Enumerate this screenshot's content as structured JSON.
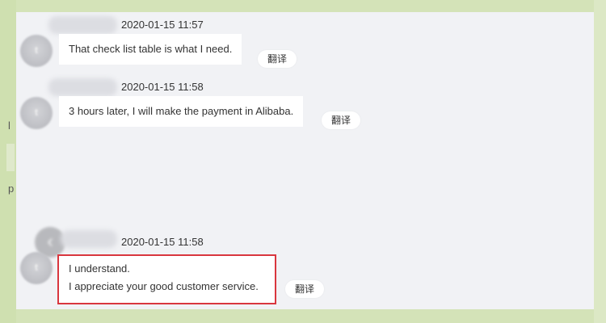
{
  "left_fragments": [
    "l",
    "p"
  ],
  "messages": [
    {
      "timestamp": "2020-01-15 11:57",
      "lines": [
        "That check list table is what I need."
      ],
      "translate_label": "翻译",
      "avatar_glyph": "t"
    },
    {
      "timestamp": "2020-01-15 11:58",
      "lines": [
        "3 hours later, I will make the payment in Alibaba."
      ],
      "translate_label": "翻译",
      "avatar_glyph": "t"
    },
    {
      "timestamp": "2020-01-15 11:58",
      "lines": [
        "I understand.",
        "I appreciate your good customer service."
      ],
      "translate_label": "翻译",
      "avatar_glyph": "t",
      "highlighted": true
    }
  ],
  "back_icon_glyph": "‹",
  "colors": {
    "outer_background": "#d4e3b8",
    "panel_background": "#f1f2f5",
    "bubble_background": "#ffffff",
    "highlight_border": "#d9363e"
  }
}
